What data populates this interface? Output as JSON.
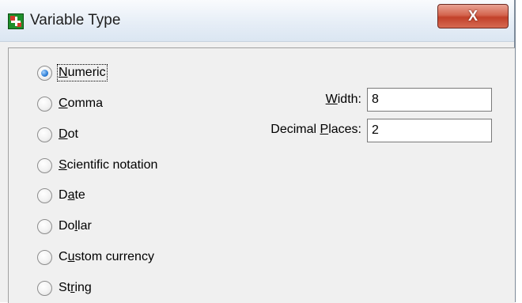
{
  "window": {
    "title": "Variable Type",
    "close_label": "X"
  },
  "radio_options": [
    {
      "pre": "",
      "ul": "N",
      "post": "umeric",
      "checked": true
    },
    {
      "pre": "",
      "ul": "C",
      "post": "omma",
      "checked": false
    },
    {
      "pre": "",
      "ul": "D",
      "post": "ot",
      "checked": false
    },
    {
      "pre": "",
      "ul": "S",
      "post": "cientific notation",
      "checked": false
    },
    {
      "pre": "D",
      "ul": "a",
      "post": "te",
      "checked": false
    },
    {
      "pre": "Do",
      "ul": "l",
      "post": "lar",
      "checked": false
    },
    {
      "pre": "C",
      "ul": "u",
      "post": "stom currency",
      "checked": false
    },
    {
      "pre": "St",
      "ul": "r",
      "post": "ing",
      "checked": false
    }
  ],
  "fields": {
    "width": {
      "label_pre": "",
      "label_ul": "W",
      "label_post": "idth:",
      "value": "8"
    },
    "decimal_places": {
      "label_pre": "Decimal ",
      "label_ul": "P",
      "label_post": "laces:",
      "value": "2"
    }
  }
}
